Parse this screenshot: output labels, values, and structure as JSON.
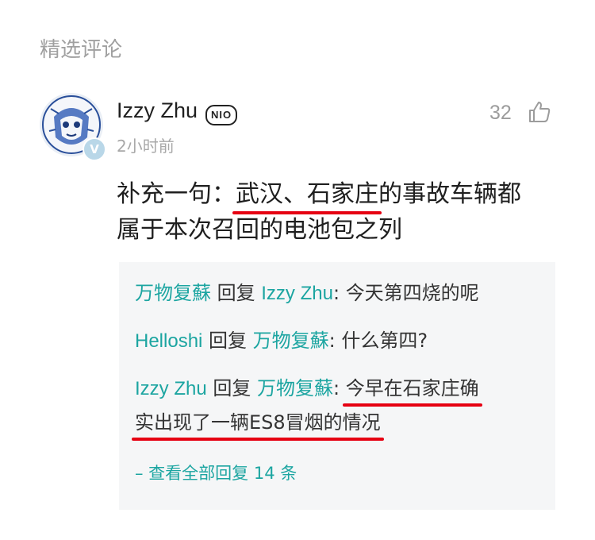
{
  "section": {
    "title": "精选评论"
  },
  "comment": {
    "username": "Izzy Zhu",
    "badge": "NIO",
    "verified_mark": "V",
    "timestamp": "2小时前",
    "likes": "32",
    "like_icon": "thumbs-up-icon",
    "text_prefix": "补充一句：",
    "text_highlight": "武汉、石家庄",
    "text_line1_rest": "的事故车辆都",
    "text_line2": "属于本次召回的电池包之列"
  },
  "replies": [
    {
      "from": "万物复蘇",
      "action": " 回复 ",
      "to": "Izzy Zhu",
      "sep": ": ",
      "text": "今天第四烧的呢"
    },
    {
      "from": "Helloshi",
      "action": " 回复 ",
      "to": "万物复蘇",
      "sep": ": ",
      "text": "什么第四?"
    },
    {
      "from": "Izzy Zhu",
      "action": " 回复 ",
      "to": "万物复蘇",
      "sep": ": ",
      "text_line1": "今早在石家庄确",
      "text_line2": "实出现了一辆ES8冒烟的情况"
    }
  ],
  "view_all": "– 查看全部回复 14 条",
  "colors": {
    "accent": "#1ca5a1",
    "highlight": "#e60012",
    "reply_bg": "#f5f6f7"
  }
}
